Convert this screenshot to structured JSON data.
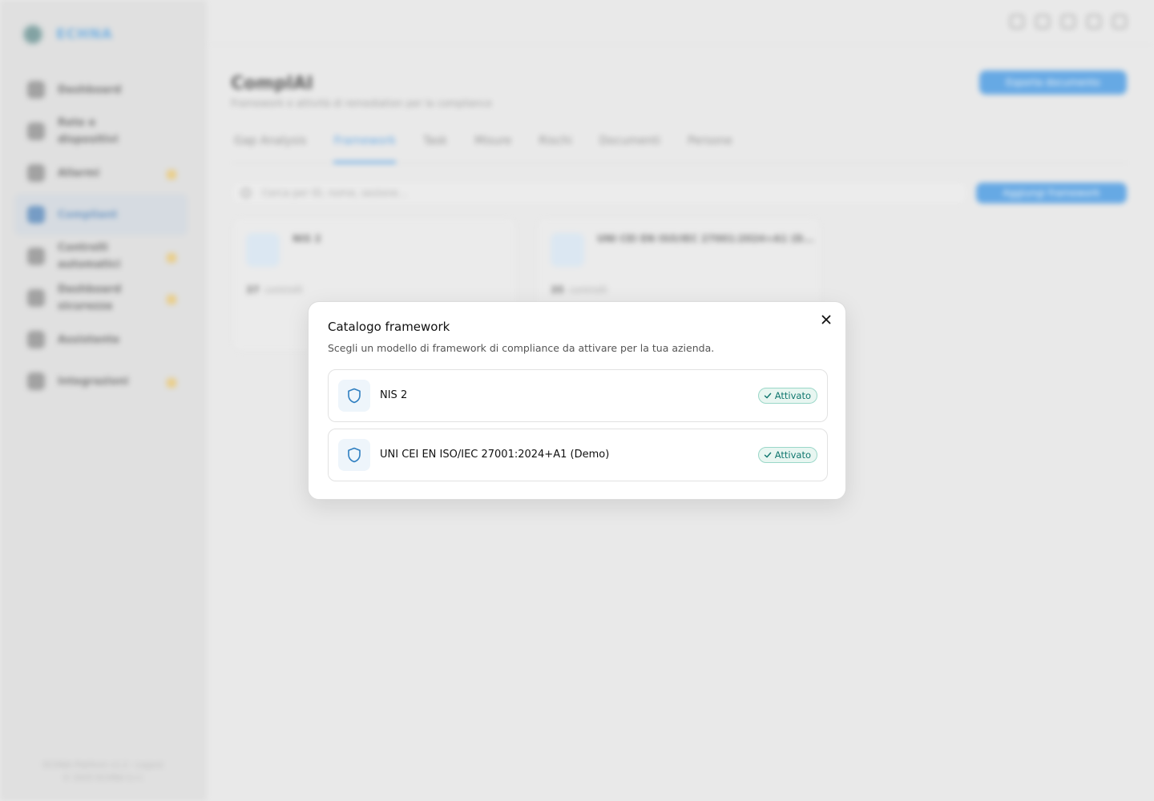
{
  "app": {
    "brand_name": "ECHNA",
    "sidebar": {
      "items": [
        {
          "label": "Dashboard",
          "badge": false
        },
        {
          "label": "Rete e dispositivi",
          "badge": false
        },
        {
          "label": "Allarmi",
          "badge": true
        },
        {
          "label": "Compliant",
          "badge": false,
          "active": true
        },
        {
          "label": "Controlli automatici",
          "badge": true
        },
        {
          "label": "Dashboard sicurezza",
          "badge": true
        },
        {
          "label": "Assistente",
          "badge": false
        },
        {
          "label": "Integrazioni",
          "badge": true
        }
      ],
      "footer_line1": "ECHNA Platform v1.2 - Logout",
      "footer_line2": "© 2025 ECHNA S.r.l."
    },
    "page": {
      "title": "ComplAI",
      "subtitle": "Framework e attività di remediation per la compliance",
      "primary_action": "Esporta documento",
      "tabs": [
        "Gap Analysis",
        "Framework",
        "Task",
        "Misure",
        "Rischi",
        "Documenti",
        "Persone"
      ],
      "active_tab": "Framework",
      "search_placeholder": "Cerca per ID, nome, sezione...",
      "add_button": "Aggiungi framework",
      "cards": [
        {
          "title": "NIS 2",
          "count": "37",
          "count_label": "controlli"
        },
        {
          "title": "UNI CEI EN ISO/IEC 27001:2024+A1 (D...",
          "count": "35",
          "count_label": "controlli"
        }
      ]
    }
  },
  "modal": {
    "title": "Catalogo framework",
    "description": "Scegli un modello di framework di compliance da attivare per la tua azienda.",
    "close_icon": "close-icon",
    "items": [
      {
        "name": "NIS 2",
        "status": "Attivato",
        "icon": "shield-icon"
      },
      {
        "name": "UNI CEI EN ISO/IEC 27001:2024+A1 (Demo)",
        "status": "Attivato",
        "icon": "shield-icon"
      }
    ]
  },
  "colors": {
    "accent": "#3a93e2",
    "success_text": "#0f766e",
    "success_bg": "#e8f6f1",
    "icon_blue": "#2f7fc1"
  }
}
